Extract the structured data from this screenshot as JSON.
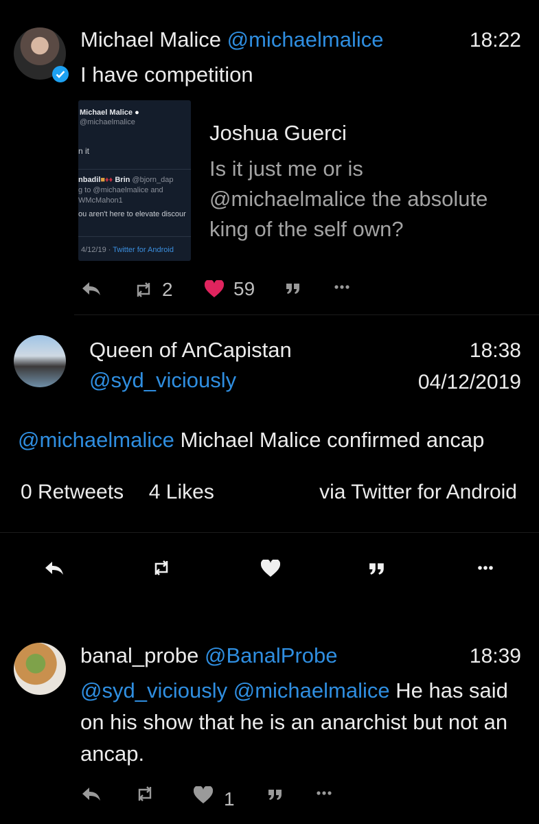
{
  "tweet1": {
    "author_name": "Michael Malice",
    "handle": "@michaelmalice",
    "time": "18:22",
    "text": "I have competition",
    "embed": {
      "name": "Michael Malice",
      "handle": "@michaelmalice",
      "partial_text": "n it",
      "reply_name": "nbadil",
      "reply_name2": "Brin",
      "reply_handle": "@bjorn_dap",
      "reply_line1": "g to @michaelmalice and",
      "reply_line2": "WMcMahon1",
      "reply_line3": "ou aren't here to elevate discour",
      "date": "4/12/19",
      "source": "Twitter for Android"
    },
    "quoted_name": "Joshua Guerci",
    "quoted_text_line1": "Is it just me or is",
    "quoted_text_line2": "@michaelmalice the absolute",
    "quoted_text_line3": "king of the self own?",
    "retweets": "2",
    "likes": "59",
    "like_color": "#e0245e"
  },
  "tweet2": {
    "author_name": "Queen of AnCapistan",
    "handle": "@syd_viciously",
    "time": "18:38",
    "date": "04/12/2019",
    "mention": "@michaelmalice",
    "text": "Michael Malice confirmed ancap",
    "retweets": "0 Retweets",
    "likes": "4 Likes",
    "source": "via Twitter for Android"
  },
  "tweet3": {
    "author_name": "banal_probe",
    "handle": "@BanalProbe",
    "time": "18:39",
    "mention1": "@syd_viciously",
    "mention2": "@michaelmalice",
    "text_line1": "He has said",
    "text_line2": "on his show that he is an anarchist but not an",
    "text_line3": "ancap.",
    "likes": "1"
  },
  "icons": [
    "reply-icon",
    "retweet-icon",
    "heart-icon",
    "quote-icon",
    "more-icon",
    "verified-icon"
  ],
  "colors": {
    "link": "#2f8ee0",
    "verified": "#1da1f2",
    "background": "#000000"
  }
}
